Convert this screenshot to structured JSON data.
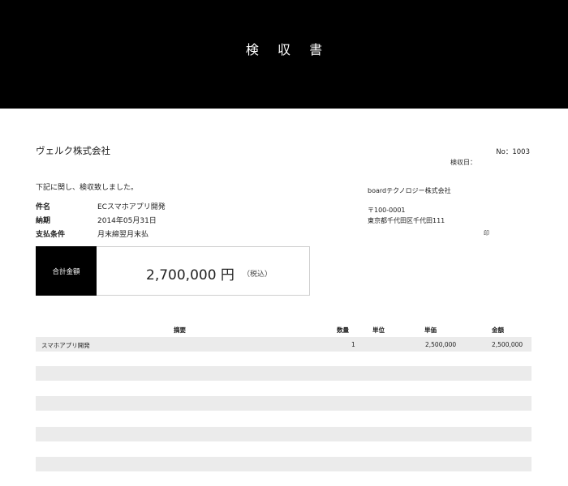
{
  "header": {
    "title": "検 収 書"
  },
  "client": {
    "name": "ヴェルク株式会社"
  },
  "meta": {
    "number": "No：1003",
    "inspect_date_label": "検収日："
  },
  "intro": "下記に関し、検収致しました。",
  "info": [
    {
      "label": "件名",
      "value": "ECスマホアプリ開発"
    },
    {
      "label": "納期",
      "value": "2014年05月31日"
    },
    {
      "label": "支払条件",
      "value": "月末締翌月末払"
    }
  ],
  "issuer": {
    "company": "boardテクノロジー株式会社",
    "postal": "〒100-0001",
    "address": "東京都千代田区千代田111",
    "seal": "印"
  },
  "total": {
    "label": "合計金額",
    "amount": "2,700,000 円",
    "tax_note": "（税込）"
  },
  "table": {
    "headers": {
      "description": "摘要",
      "quantity": "数量",
      "unit": "単位",
      "unit_price": "単価",
      "amount": "金額"
    },
    "rows": [
      {
        "description": "スマホアプリ開発",
        "quantity": "1",
        "unit": "",
        "unit_price": "2,500,000",
        "amount": "2,500,000"
      },
      {
        "description": "",
        "quantity": "",
        "unit": "",
        "unit_price": "",
        "amount": ""
      },
      {
        "description": "",
        "quantity": "",
        "unit": "",
        "unit_price": "",
        "amount": ""
      },
      {
        "description": "",
        "quantity": "",
        "unit": "",
        "unit_price": "",
        "amount": ""
      },
      {
        "description": "",
        "quantity": "",
        "unit": "",
        "unit_price": "",
        "amount": ""
      },
      {
        "description": "",
        "quantity": "",
        "unit": "",
        "unit_price": "",
        "amount": ""
      },
      {
        "description": "",
        "quantity": "",
        "unit": "",
        "unit_price": "",
        "amount": ""
      },
      {
        "description": "",
        "quantity": "",
        "unit": "",
        "unit_price": "",
        "amount": ""
      },
      {
        "description": "",
        "quantity": "",
        "unit": "",
        "unit_price": "",
        "amount": ""
      }
    ]
  }
}
